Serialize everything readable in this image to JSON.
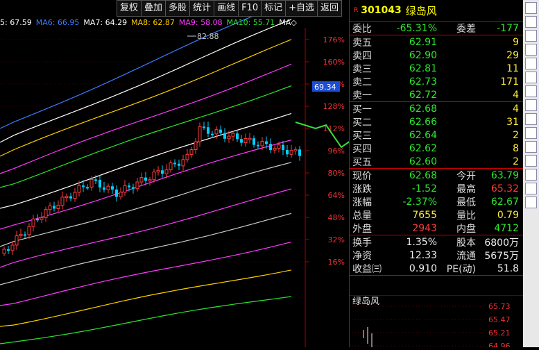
{
  "toolbar": [
    "复权",
    "叠加",
    "多股",
    "统计",
    "画线",
    "F10",
    "标记",
    "+自选",
    "返回"
  ],
  "ma_legend": [
    {
      "text": "5: 67.59",
      "color": "#ffffff"
    },
    {
      "text": "MA6: 66.95",
      "color": "#3a7dff"
    },
    {
      "text": "MA7: 64.29",
      "color": "#ffffff"
    },
    {
      "text": "MA8: 62.87",
      "color": "#ffd000"
    },
    {
      "text": "MA9: 58.08",
      "color": "#ff3bff"
    },
    {
      "text": "MA10: 55.71",
      "color": "#2ce62c"
    },
    {
      "text": "MA◇",
      "color": "#ffffff"
    }
  ],
  "chart": {
    "high_label": "82.88",
    "current_price_tag": "69.34",
    "y_axis": [
      "176%",
      "160%",
      "144%",
      "128%",
      "112%",
      "96%",
      "80%",
      "64%",
      "48%",
      "32%",
      "16%"
    ]
  },
  "quote": {
    "flag": "R",
    "code": "301043",
    "name": "绿岛风",
    "weibi": {
      "label": "委比",
      "value": "-65.31%",
      "label2": "委差",
      "value2": "-177"
    },
    "sell": [
      {
        "label": "卖五",
        "price": "62.91",
        "vol": "9"
      },
      {
        "label": "卖四",
        "price": "62.90",
        "vol": "29"
      },
      {
        "label": "卖三",
        "price": "62.81",
        "vol": "11"
      },
      {
        "label": "卖二",
        "price": "62.73",
        "vol": "171"
      },
      {
        "label": "卖一",
        "price": "62.72",
        "vol": "4"
      }
    ],
    "buy": [
      {
        "label": "买一",
        "price": "62.68",
        "vol": "4"
      },
      {
        "label": "买二",
        "price": "62.66",
        "vol": "31"
      },
      {
        "label": "买三",
        "price": "62.64",
        "vol": "2"
      },
      {
        "label": "买四",
        "price": "62.62",
        "vol": "8"
      },
      {
        "label": "买五",
        "price": "62.60",
        "vol": "2"
      }
    ],
    "stats": [
      {
        "l1": "现价",
        "v1": "62.68",
        "c1": "green",
        "l2": "今开",
        "v2": "63.79",
        "c2": "green"
      },
      {
        "l1": "涨跌",
        "v1": "-1.52",
        "c1": "green",
        "l2": "最高",
        "v2": "65.32",
        "c2": "red"
      },
      {
        "l1": "涨幅",
        "v1": "-2.37%",
        "c1": "green",
        "l2": "最低",
        "v2": "62.67",
        "c2": "green"
      },
      {
        "l1": "总量",
        "v1": "7655",
        "c1": "yellow",
        "l2": "量比",
        "v2": "0.79",
        "c2": "yellow"
      },
      {
        "l1": "外盘",
        "v1": "2943",
        "c1": "red",
        "l2": "内盘",
        "v2": "4712",
        "c2": "green"
      }
    ],
    "extra": [
      {
        "l1": "换手",
        "v1": "1.35%",
        "l2": "股本",
        "v2": "6800万"
      },
      {
        "l1": "净资",
        "v1": "12.33",
        "l2": "流通",
        "v2": "5675万"
      },
      {
        "l1": "收益㈢",
        "v1": "0.910",
        "l2": "PE(动)",
        "v2": "51.8"
      }
    ]
  },
  "mini": {
    "title": "绿岛风",
    "prices": [
      "65.73",
      "65.47",
      "65.21",
      "64.96"
    ]
  },
  "tool_icons": [
    "expand-icon",
    "arrow-icon",
    "trend-icon",
    "line-icon",
    "up-icon",
    "candle-icon",
    "bar-icon",
    "fund-icon",
    "f10-icon",
    "fz-icon",
    "fc-icon",
    "doc-icon",
    "rsi-icon",
    "grid-icon",
    "graph-icon"
  ]
}
